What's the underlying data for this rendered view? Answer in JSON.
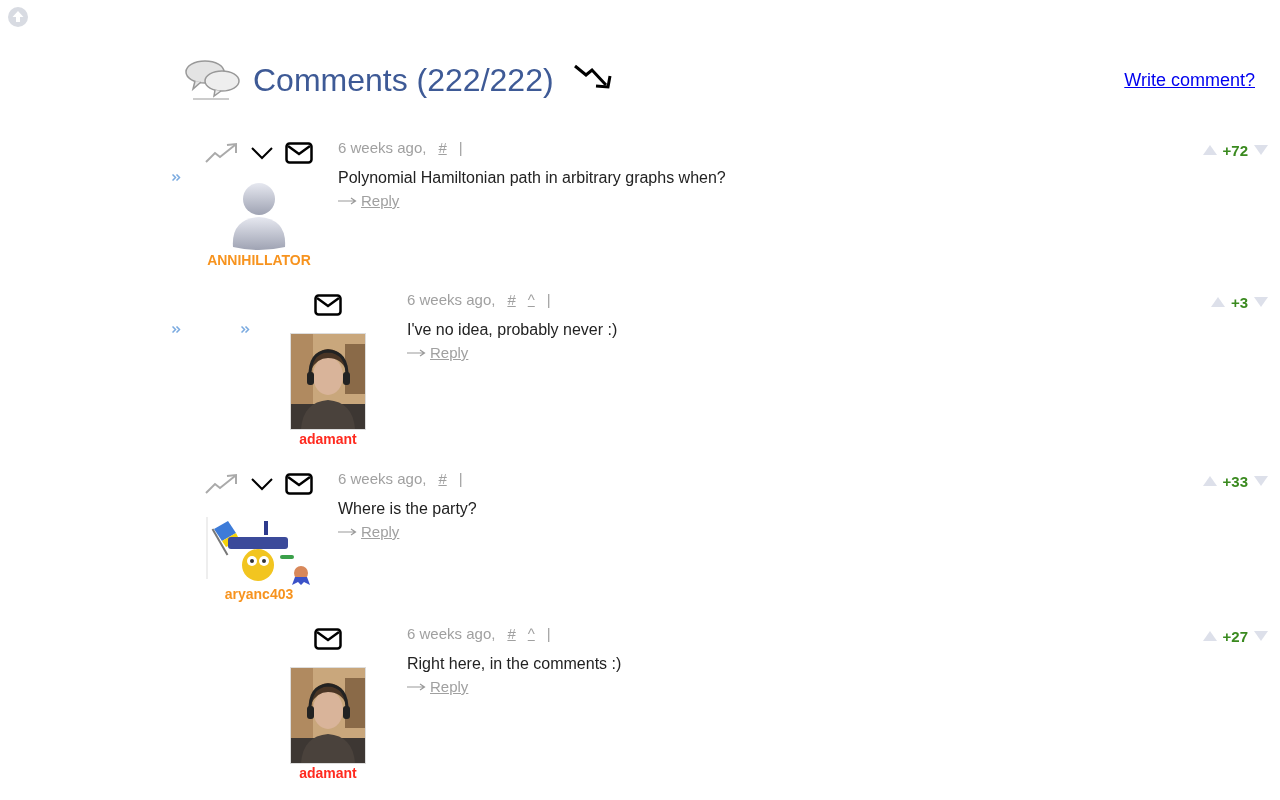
{
  "header": {
    "title": "Comments (222/222)",
    "write_link": "Write comment?"
  },
  "comments": [
    {
      "author": {
        "name": "ANNIHILLATOR",
        "color": "#f7931e",
        "kind": "icon"
      },
      "time": "6 weeks ago,",
      "anchor": "#",
      "separator": "|",
      "text": "Polynomial Hamiltonian path in arbitrary graphs when?",
      "reply": "Reply",
      "score": "+72",
      "marked": true,
      "children": [
        {
          "author": {
            "name": "adamant",
            "color": "#ff2a1f"
          },
          "time": "6 weeks ago,",
          "anchor": "#",
          "parent_link": "^",
          "separator": "|",
          "text": "I've no idea, probably never :)",
          "reply": "Reply",
          "score": "+3",
          "marked": true
        }
      ]
    },
    {
      "author": {
        "name": "aryanc403",
        "color": "#f7931e",
        "kind": "badge"
      },
      "time": "6 weeks ago,",
      "anchor": "#",
      "separator": "|",
      "text": "Where is the party?",
      "reply": "Reply",
      "score": "+33",
      "marked": false,
      "children": [
        {
          "author": {
            "name": "adamant",
            "color": "#ff2a1f"
          },
          "time": "6 weeks ago,",
          "anchor": "#",
          "parent_link": "^",
          "separator": "|",
          "text": "Right here, in the comments :)",
          "reply": "Reply",
          "score": "+27",
          "marked": false
        }
      ]
    }
  ]
}
